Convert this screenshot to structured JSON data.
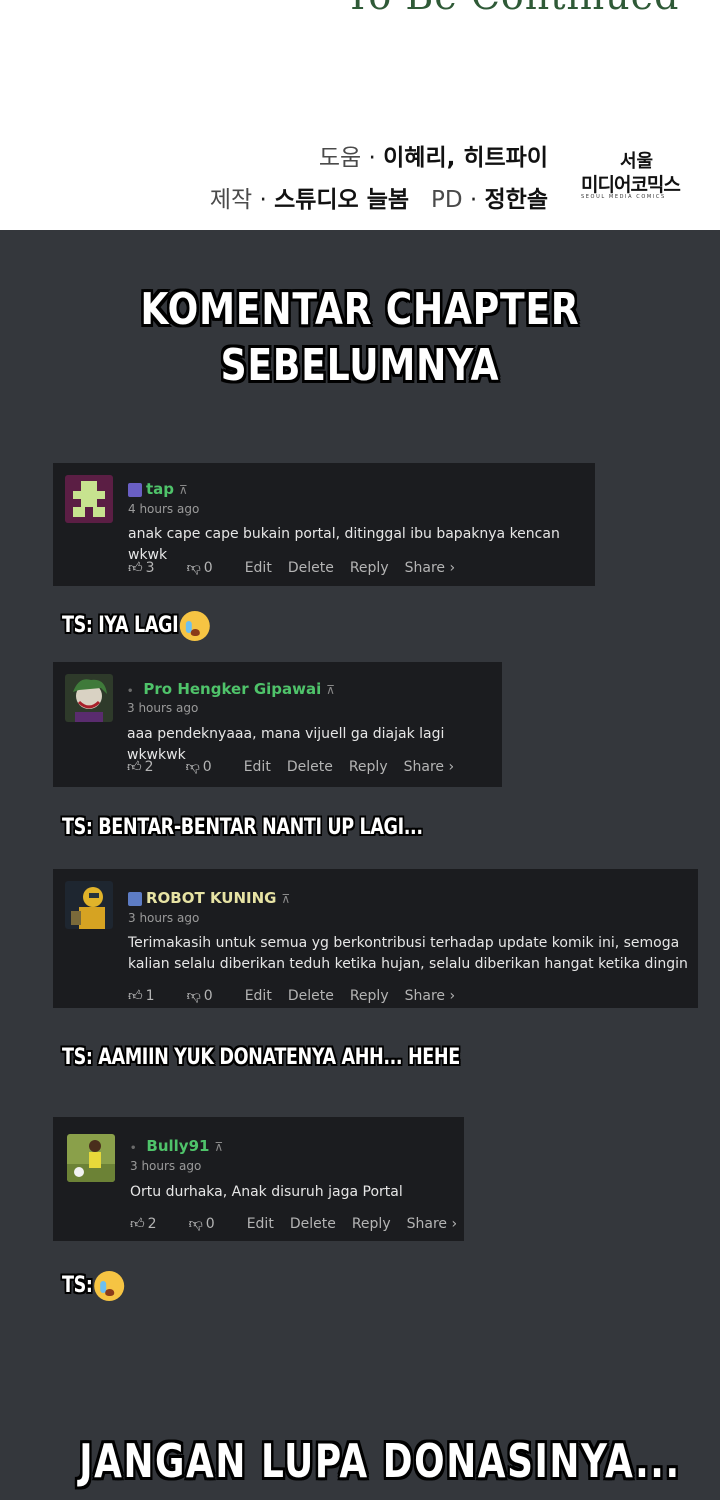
{
  "header": {
    "to_be_continued": "To Be Continued",
    "credit_line1": {
      "label": "도움",
      "names": "이혜리, 히트파이"
    },
    "credit_line2": {
      "label": "제작",
      "studio": "스튜디오 늘봄",
      "pd_label": "PD",
      "pd_name": "정한솔"
    },
    "logo": {
      "line1": "서울",
      "line2": "미디어코믹스",
      "line3": "SEOUL MEDIA COMICS"
    }
  },
  "title": {
    "line1": "KOMENTAR CHAPTER",
    "line2": "SEBELUMNYA"
  },
  "comments": [
    {
      "username": "tap",
      "time": "4 hours ago",
      "text": "anak cape cape bukain portal, ditinggal ibu bapaknya kencan wkwk",
      "likes": "3",
      "dislikes": "0",
      "name_color": "#4fc36a"
    },
    {
      "username": "Pro Hengker Gipawai",
      "time": "3 hours ago",
      "text": "aaa pendeknyaaa, mana vijuell ga diajak lagi wkwkwk",
      "likes": "2",
      "dislikes": "0",
      "name_color": "#4fc36a"
    },
    {
      "username": "ROBOT KUNING",
      "time": "3 hours ago",
      "text": "Terimakasih untuk semua yg berkontribusi terhadap update komik ini, semoga kalian selalu diberikan teduh ketika hujan, selalu diberikan hangat ketika dingin",
      "likes": "1",
      "dislikes": "0",
      "name_color": "#e7e3a4"
    },
    {
      "username": "Bully91",
      "time": "3 hours ago",
      "text": "Ortu durhaka, Anak disuruh jaga Portal",
      "likes": "2",
      "dislikes": "0",
      "name_color": "#4fc36a"
    }
  ],
  "actions": {
    "edit": "Edit",
    "delete": "Delete",
    "reply": "Reply",
    "share": "Share ›"
  },
  "replies": [
    "TS: IYA LAGI",
    "TS: BENTAR-BENTAR NANTI UP LAGI...",
    "TS: AAMIIN YUK DONATENYA AHH... HEHE",
    "TS:"
  ],
  "footer": {
    "text": "JANGAN LUPA DONASINYA..."
  },
  "colors": {
    "background": "#34373c",
    "card": "#1b1c1f",
    "green": "#4fc36a"
  }
}
